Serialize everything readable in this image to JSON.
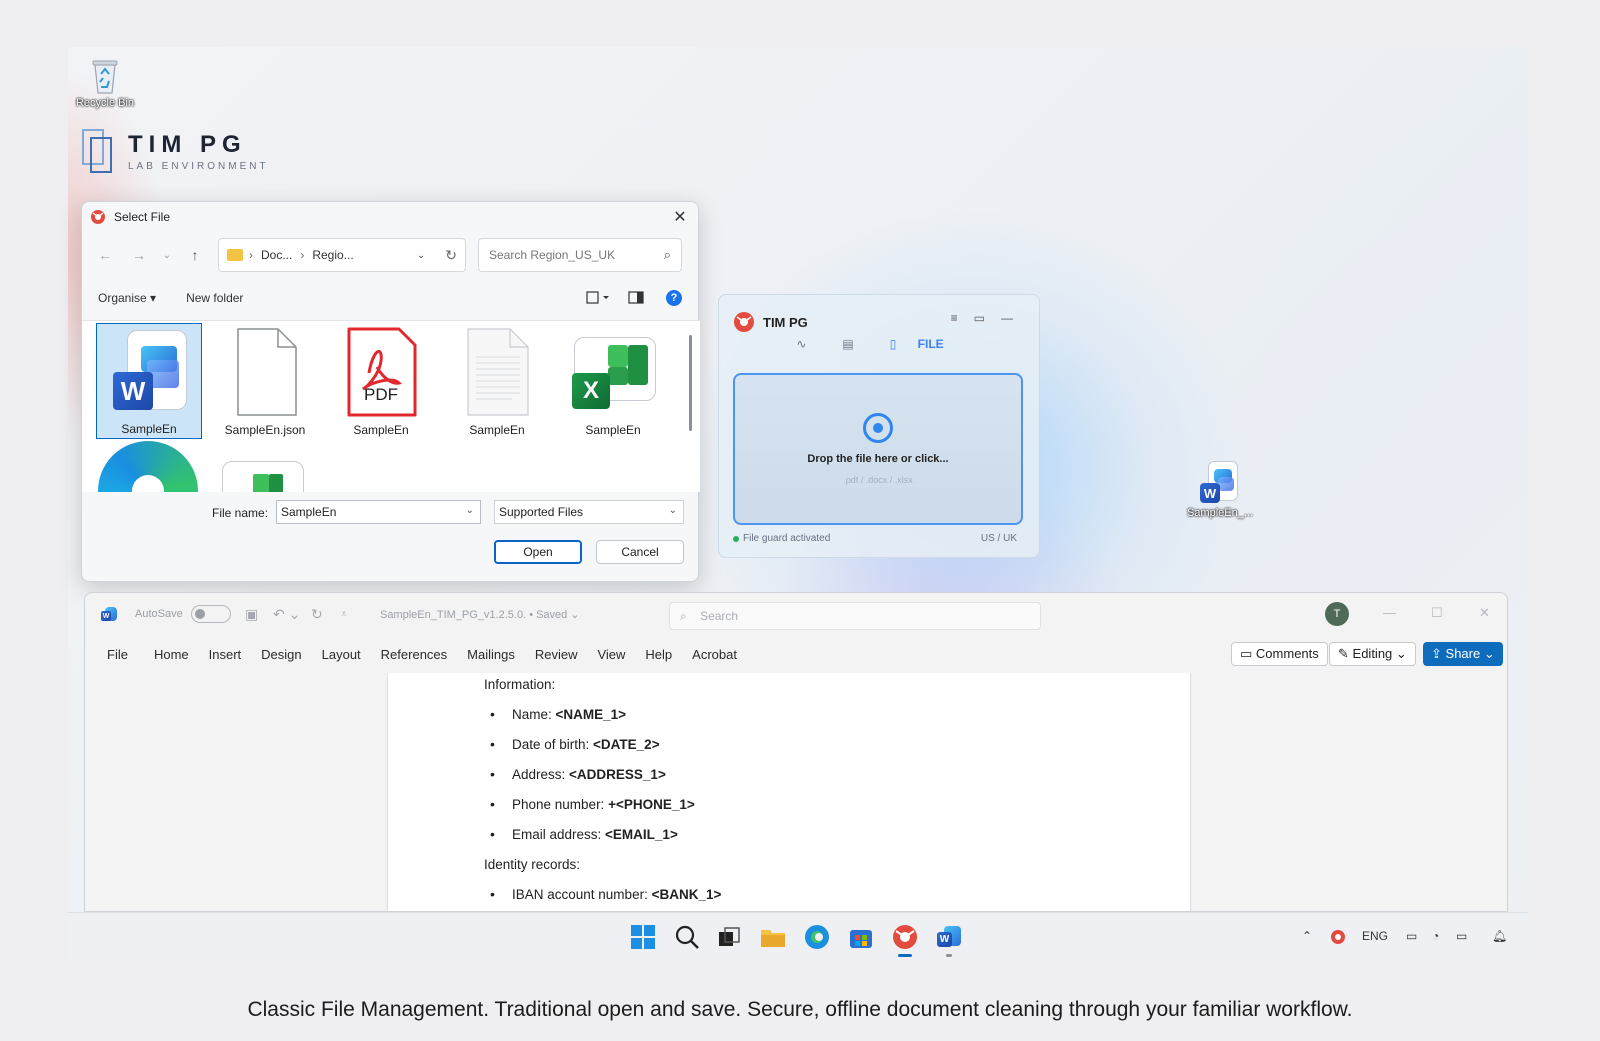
{
  "desktop": {
    "recycle_bin_label": "Recycle Bin",
    "brand_name": "TIM PG",
    "brand_sub": "LAB ENVIRONMENT",
    "word_icon_label": "SampleEn_..."
  },
  "dialog": {
    "title": "Select File",
    "close": "✕",
    "path": [
      "Doc...",
      "Regio..."
    ],
    "search_placeholder": "Search Region_US_UK",
    "organise_label": "Organise ▾",
    "new_folder_label": "New folder",
    "help_label": "?",
    "files": [
      {
        "name": "SampleEn",
        "type": "word",
        "selected": true
      },
      {
        "name": "SampleEn.json",
        "type": "json"
      },
      {
        "name": "SampleEn",
        "type": "pdf"
      },
      {
        "name": "SampleEn",
        "type": "text"
      },
      {
        "name": "SampleEn",
        "type": "excel"
      }
    ],
    "pdf_label": "PDF",
    "word_letter": "W",
    "excel_letter": "X",
    "file_name_label": "File name:",
    "file_name_value": "SampleEn",
    "file_type_value": "Supported Files",
    "open_label": "Open",
    "cancel_label": "Cancel"
  },
  "widget": {
    "title": "TIM PG",
    "tab_file": "FILE",
    "drop_text": "Drop the file here or click...",
    "drop_types": ".pdf / .docx / .xlsx",
    "status": "File guard activated",
    "region": "US / UK"
  },
  "word": {
    "autosave_label": "AutoSave",
    "doc_title": "SampleEn_TIM_PG_v1.2.5.0. • Saved ⌄",
    "search_placeholder": "Search",
    "avatar_initial": "T",
    "ribbon_tabs": [
      "File",
      "Home",
      "Insert",
      "Design",
      "Layout",
      "References",
      "Mailings",
      "Review",
      "View",
      "Help",
      "Acrobat"
    ],
    "comments_label": "Comments",
    "editing_label": "Editing ⌄",
    "share_label": "Share ⌄",
    "content": {
      "heading_info": "Information:",
      "items": [
        {
          "label": "Name: ",
          "value": "<NAME_1>"
        },
        {
          "label": "Date of birth: ",
          "value": "<DATE_2>"
        },
        {
          "label": "Address: ",
          "value": "<ADDRESS_1>"
        },
        {
          "label": "Phone number: ",
          "value": "+<PHONE_1>"
        },
        {
          "label": "Email address: ",
          "value": "<EMAIL_1>"
        }
      ],
      "heading_identity": "Identity records:",
      "identity_items": [
        {
          "label": "IBAN account number: ",
          "value": "<BANK_1>"
        }
      ]
    }
  },
  "taskbar": {
    "tray_language": "ENG"
  },
  "caption": "Classic File Management. Traditional open and save. Secure, offline document cleaning through your familiar workflow.",
  "colors": {
    "accent": "#0f6cbd",
    "drop_border": "#4d95f0",
    "status_green": "#27ae60"
  }
}
